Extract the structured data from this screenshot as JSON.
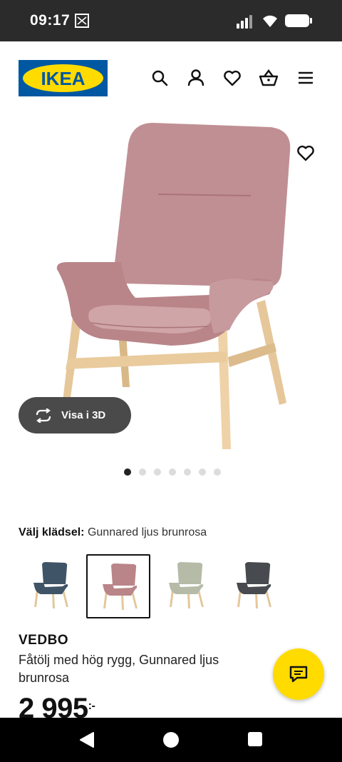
{
  "status_bar": {
    "time": "09:17"
  },
  "header": {
    "logo_text": "IKEA",
    "icons": [
      "search-icon",
      "user-icon",
      "heart-icon",
      "basket-icon",
      "menu-icon"
    ]
  },
  "hero": {
    "view_3d_label": "Visa i 3D",
    "image_count": 7,
    "active_index": 0
  },
  "variant_selector": {
    "label": "Välj klädsel:",
    "selected_value": "Gunnared ljus brunrosa",
    "swatches": [
      {
        "color": "#3f5466",
        "selected": false
      },
      {
        "color": "#b98589",
        "selected": true
      },
      {
        "color": "#b6bba8",
        "selected": false
      },
      {
        "color": "#474a4e",
        "selected": false
      }
    ]
  },
  "product": {
    "name": "VEDBO",
    "description": "Fåtölj med hög rygg, Gunnared ljus brunrosa",
    "price": "2 995",
    "price_suffix": ":-"
  },
  "colors": {
    "ikea_blue": "#0058a3",
    "ikea_yellow": "#ffdb00",
    "status_bar": "#2b2b2b"
  }
}
